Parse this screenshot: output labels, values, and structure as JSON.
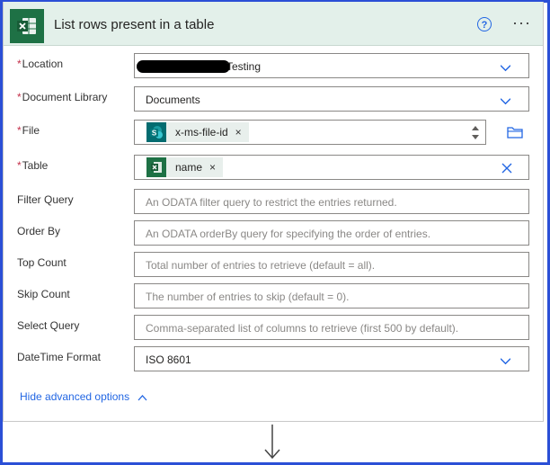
{
  "header": {
    "title": "List rows present in a table",
    "icon": "excel-icon",
    "help_icon": "help-icon",
    "more_icon": "more-icon",
    "more_label": "···",
    "help_label": "?"
  },
  "fields": {
    "location": {
      "required": "*",
      "label": "Location",
      "value": "Testing"
    },
    "document_library": {
      "required": "*",
      "label": "Document Library",
      "value": "Documents"
    },
    "file": {
      "required": "*",
      "label": "File",
      "token": "x-ms-file-id",
      "token_close": "×"
    },
    "table": {
      "required": "*",
      "label": "Table",
      "token": "name",
      "token_close": "×"
    },
    "filter_query": {
      "label": "Filter Query",
      "placeholder": "An ODATA filter query to restrict the entries returned."
    },
    "order_by": {
      "label": "Order By",
      "placeholder": "An ODATA orderBy query for specifying the order of entries."
    },
    "top_count": {
      "label": "Top Count",
      "placeholder": "Total number of entries to retrieve (default = all)."
    },
    "skip_count": {
      "label": "Skip Count",
      "placeholder": "The number of entries to skip (default = 0)."
    },
    "select_query": {
      "label": "Select Query",
      "placeholder": "Comma-separated list of columns to retrieve (first 500 by default)."
    },
    "datetime_format": {
      "label": "DateTime Format",
      "value": "ISO 8601"
    }
  },
  "advanced": {
    "label": "Hide advanced options"
  },
  "colors": {
    "accent": "#2266e3",
    "excel_green": "#1e7145",
    "sharepoint_teal": "#036c70",
    "header_bg": "#e3f0ea",
    "required": "#c4314b",
    "frame": "#2b4fd6"
  }
}
